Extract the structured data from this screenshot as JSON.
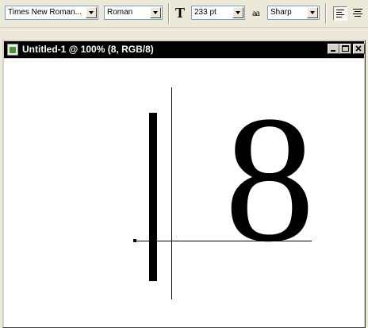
{
  "options_bar": {
    "font_family": "Times New Roman...",
    "font_style": "Roman",
    "font_size_icon": "T",
    "font_size": "233 pt",
    "antialias_icon": "aa",
    "antialias": "Sharp"
  },
  "document": {
    "title": "Untitled-1 @ 100% (8, RGB/8)",
    "text_content": "8"
  }
}
